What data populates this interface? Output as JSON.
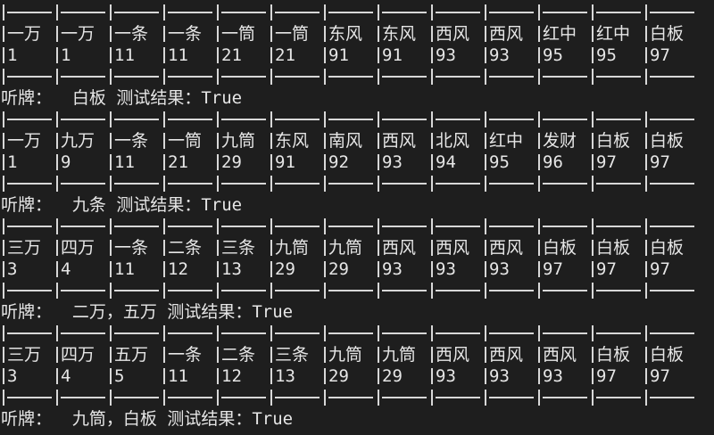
{
  "terminal": {
    "hands": [
      {
        "names": [
          "一万",
          "一万",
          "一条",
          "一条",
          "一筒",
          "一筒",
          "东风",
          "东风",
          "西风",
          "西风",
          "红中",
          "红中",
          "白板"
        ],
        "codes": [
          "1",
          "1",
          "11",
          "11",
          "21",
          "21",
          "91",
          "91",
          "93",
          "93",
          "95",
          "95",
          "97"
        ],
        "result": "听牌：  白板 测试结果：True"
      },
      {
        "names": [
          "一万",
          "九万",
          "一条",
          "一筒",
          "九筒",
          "东风",
          "南风",
          "西风",
          "北风",
          "红中",
          "发财",
          "白板",
          "白板"
        ],
        "codes": [
          "1",
          "9",
          "11",
          "21",
          "29",
          "91",
          "92",
          "93",
          "94",
          "95",
          "96",
          "97",
          "97"
        ],
        "result": "听牌：  九条 测试结果：True"
      },
      {
        "names": [
          "三万",
          "四万",
          "一条",
          "二条",
          "三条",
          "九筒",
          "九筒",
          "西风",
          "西风",
          "西风",
          "白板",
          "白板",
          "白板"
        ],
        "codes": [
          "3",
          "4",
          "11",
          "12",
          "13",
          "29",
          "29",
          "93",
          "93",
          "93",
          "97",
          "97",
          "97"
        ],
        "result": "听牌：  二万，五万 测试结果：True"
      },
      {
        "names": [
          "三万",
          "四万",
          "五万",
          "一条",
          "二条",
          "三条",
          "九筒",
          "九筒",
          "西风",
          "西风",
          "西风",
          "白板",
          "白板"
        ],
        "codes": [
          "3",
          "4",
          "5",
          "11",
          "12",
          "13",
          "29",
          "29",
          "93",
          "93",
          "93",
          "97",
          "97"
        ],
        "result": "听牌：  九筒，白板 测试结果：True"
      }
    ]
  }
}
